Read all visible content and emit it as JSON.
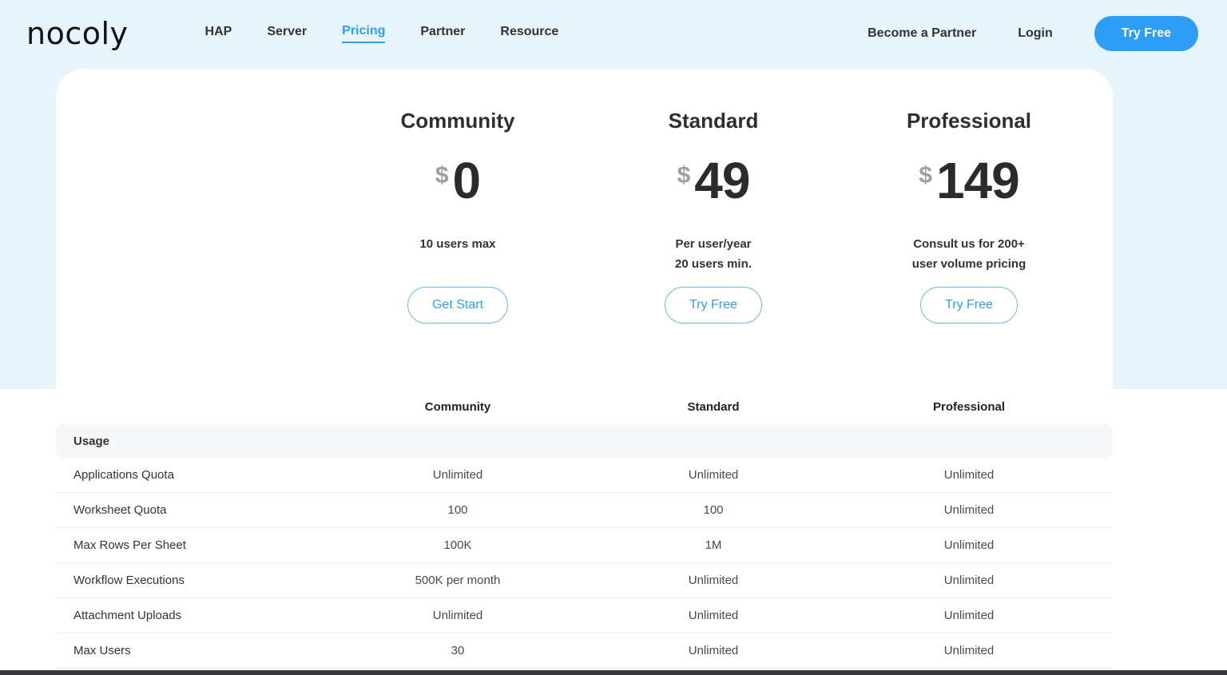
{
  "brand": {
    "logo": "nocoly"
  },
  "nav": {
    "items": [
      {
        "label": "HAP"
      },
      {
        "label": "Server"
      },
      {
        "label": "Pricing"
      },
      {
        "label": "Partner"
      },
      {
        "label": "Resource"
      }
    ],
    "active_item": "Pricing",
    "become_partner": "Become a Partner",
    "login": "Login",
    "try_free": "Try Free"
  },
  "pricing": {
    "plans": [
      {
        "name": "Community",
        "currency": "$",
        "price": "0",
        "line1": "10 users max",
        "line2": "",
        "button": "Get Start"
      },
      {
        "name": "Standard",
        "currency": "$",
        "price": "49",
        "line1": "Per user/year",
        "line2": "20 users min.",
        "button": "Try Free"
      },
      {
        "name": "Professional",
        "currency": "$",
        "price": "149",
        "line1": "Consult us for 200+",
        "line2": "user volume pricing",
        "button": "Try Free"
      }
    ]
  },
  "table": {
    "columns": [
      "Community",
      "Standard",
      "Professional"
    ],
    "section_title": "Usage",
    "rows": [
      {
        "label": "Applications Quota",
        "values": [
          "Unlimited",
          "Unlimited",
          "Unlimited"
        ]
      },
      {
        "label": "Worksheet Quota",
        "values": [
          "100",
          "100",
          "Unlimited"
        ]
      },
      {
        "label": "Max Rows Per Sheet",
        "values": [
          "100K",
          "1M",
          "Unlimited"
        ]
      },
      {
        "label": "Workflow Executions",
        "values": [
          "500K per month",
          "Unlimited",
          "Unlimited"
        ]
      },
      {
        "label": "Attachment Uploads",
        "values": [
          "Unlimited",
          "Unlimited",
          "Unlimited"
        ]
      },
      {
        "label": "Max Users",
        "values": [
          "30",
          "Unlimited",
          "Unlimited"
        ]
      }
    ]
  },
  "colors": {
    "accent": "#2e9df5",
    "top_background": "#e8f4fc",
    "card_background": "#ffffff",
    "section_row_background": "#f6f7f8",
    "price_text": "#2b2b2b",
    "currency_text": "#9e9e9e",
    "footer_strip": "#38383a"
  }
}
